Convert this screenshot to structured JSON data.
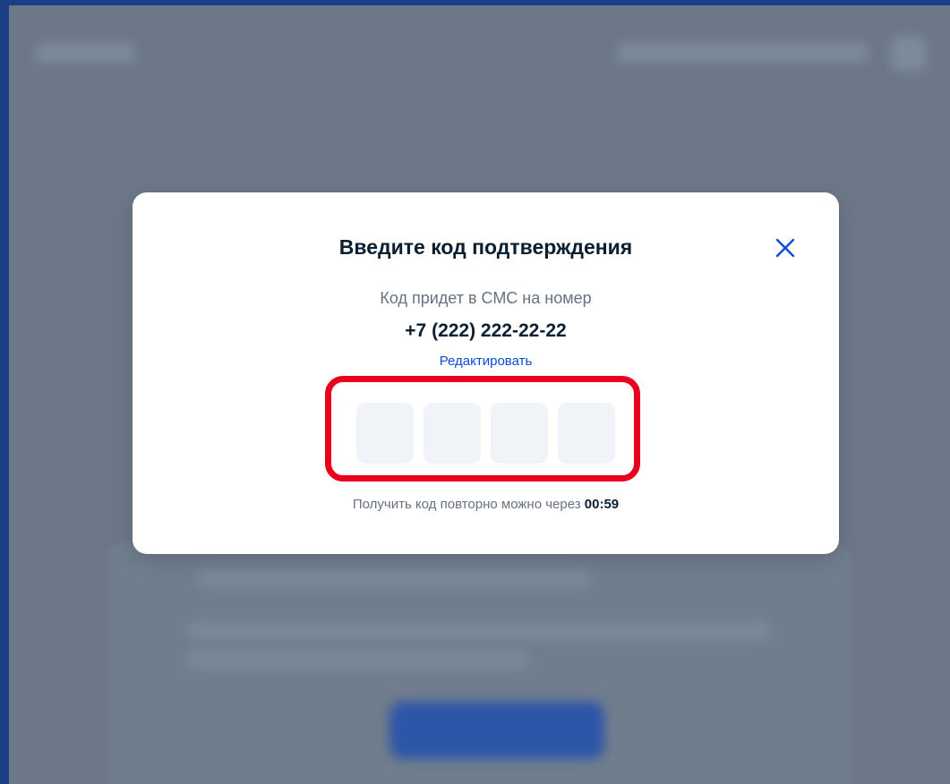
{
  "modal": {
    "title": "Введите код подтверждения",
    "subtitle": "Код придет в СМС на номер",
    "phone": "+7 (222) 222-22-22",
    "edit_label": "Редактировать",
    "code_cells": [
      "",
      "",
      "",
      ""
    ],
    "resend_text": "Получить код повторно можно через",
    "resend_timer": "00:59",
    "close_icon": "close-icon"
  },
  "colors": {
    "accent": "#0d4cd3",
    "highlight": "#e8001c",
    "overlay": "#6c7888",
    "frame": "#1b3f86"
  }
}
